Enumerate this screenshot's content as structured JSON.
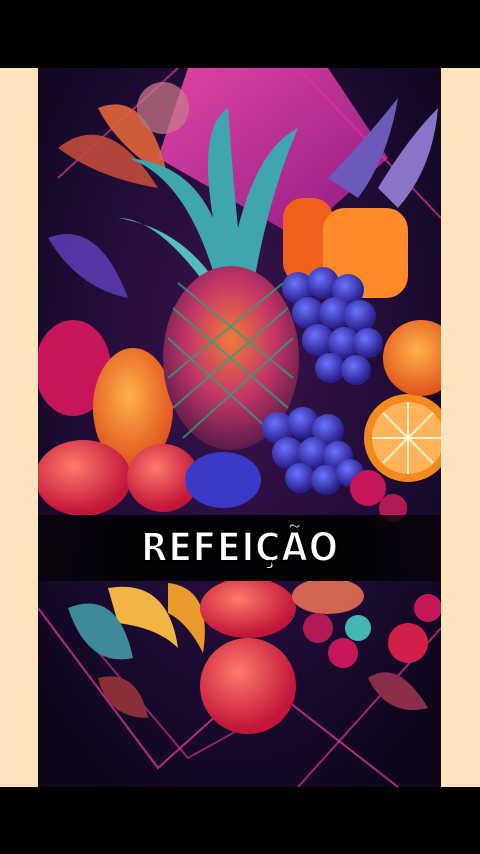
{
  "caption": {
    "text": "REFEIÇÃO"
  },
  "colors": {
    "letterbox": "#000000",
    "side_bars": "#fde3be",
    "background": "#1a0b2e",
    "accent_pink": "#e0339a",
    "accent_orange": "#f38a1f"
  },
  "scene": {
    "icons": [
      "pineapple-icon",
      "grapes-icon",
      "orange-slice-icon",
      "apple-icon",
      "pepper-icon",
      "banana-icon",
      "berries-icon"
    ]
  }
}
